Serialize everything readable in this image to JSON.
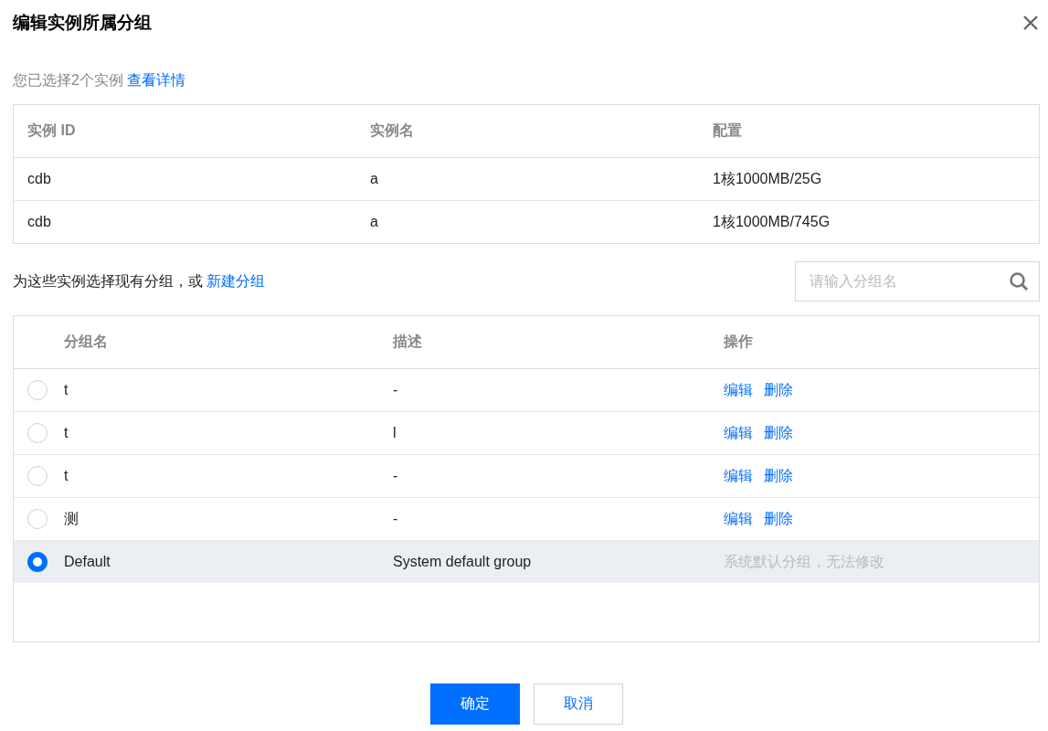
{
  "dialog": {
    "title": "编辑实例所属分组"
  },
  "selection_note": {
    "text": "您已选择2个实例",
    "link": "查看详情"
  },
  "instances": {
    "columns": [
      "实例 ID",
      "实例名",
      "配置"
    ],
    "rows": [
      [
        "cdb",
        "a",
        "1核1000MB/25G"
      ],
      [
        "cdb",
        "a",
        "1核1000MB/745G"
      ]
    ]
  },
  "group_prompt": {
    "text": "为这些实例选择现有分组，或",
    "link": "新建分组"
  },
  "search": {
    "placeholder": "请输入分组名"
  },
  "groups": {
    "columns": [
      "分组名",
      "描述",
      "操作"
    ],
    "rows": [
      {
        "name": "t",
        "description": "-",
        "actions": [
          "编辑",
          "删除"
        ],
        "selected": false
      },
      {
        "name": "t",
        "description": "l",
        "actions": [
          "编辑",
          "删除"
        ],
        "selected": false
      },
      {
        "name": "t",
        "description": "-",
        "actions": [
          "编辑",
          "删除"
        ],
        "selected": false
      },
      {
        "name": "测",
        "description": "-",
        "actions": [
          "编辑",
          "删除"
        ],
        "selected": false
      },
      {
        "name": "Default",
        "description": "System default group",
        "note": "系统默认分组，无法修改",
        "selected": true
      }
    ]
  },
  "buttons": [
    {
      "label": "确定",
      "kind": "primary"
    },
    {
      "label": "取消",
      "kind": "secondary"
    }
  ]
}
